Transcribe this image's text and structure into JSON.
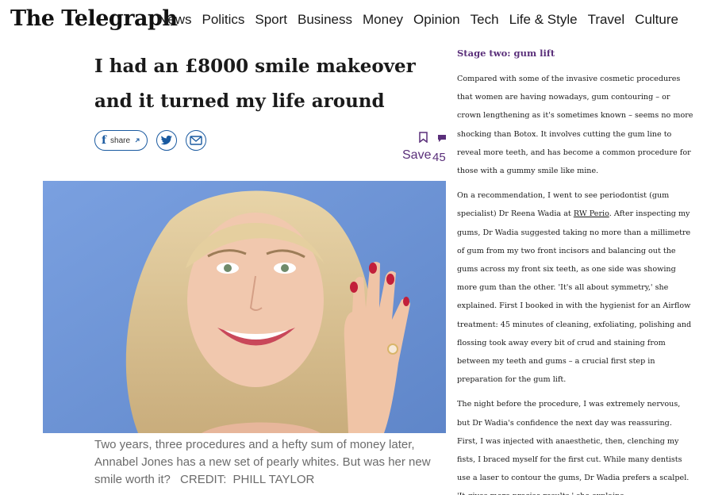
{
  "masthead": {
    "logo": "The Telegraph",
    "nav": [
      "News",
      "Politics",
      "Sport",
      "Business",
      "Money",
      "Opinion",
      "Tech",
      "Life & Style",
      "Travel",
      "Culture"
    ]
  },
  "article": {
    "headline": "I had an £8000 smile makeover and it turned my life around",
    "share": {
      "facebook_label": "share"
    },
    "save_label": "Save",
    "comment_count": "45",
    "caption": "Two years, three procedures and a hefty sum of money later, Annabel Jones has a new set of pearly whites. But was her new smile worth it?",
    "credit_label": "CREDIT:",
    "credit_name": "PHILL TAYLOR"
  },
  "body": {
    "subhead": "Stage two: gum lift",
    "p1": "Compared with some of the invasive cosmetic procedures that women are having nowadays, gum contouring – or crown lengthening as it's sometimes known – seems no more shocking than Botox. It involves cutting the gum line to reveal more teeth, and has become a common procedure for those with a gummy smile like mine.",
    "p2_before": "On a recommendation, I went to see periodontist (gum specialist) Dr Reena Wadia at ",
    "p2_link": "RW Perio",
    "p2_after": ". After inspecting my gums, Dr Wadia suggested taking no more than a millimetre of gum from my two front incisors and balancing out the gums across my front six teeth, as one side was showing more gum than the other. 'It's all about symmetry,' she explained. First I booked in with the hygienist for an Airflow treatment: 45 minutes of cleaning, exfoliating, polishing and flossing took away every bit of crud and staining from between my teeth and gums – a crucial first step in preparation for the gum lift.",
    "p3": "The night before the procedure, I was extremely nervous, but Dr Wadia's confidence the next day was reassuring. First, I was injected with anaesthetic, then, clenching my fists, I braced myself for the first cut. While many dentists use a laser to contour the gums, Dr Wadia prefers a scalpel. 'It gives more precise results,' she explains."
  },
  "colors": {
    "accent_purple": "#5a2f7a",
    "share_blue": "#1a5aa0",
    "hero_bg": "#6d95d8"
  }
}
